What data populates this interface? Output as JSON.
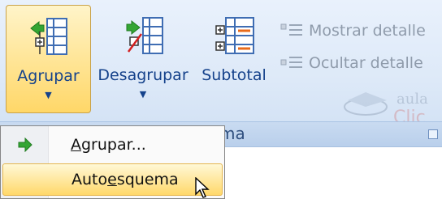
{
  "ribbon": {
    "group_label": "ma",
    "buttons": {
      "agrupar": "Agrupar",
      "desagrupar": "Desagrupar",
      "subtotal": "Subtotal",
      "mostrar_detalle": "Mostrar detalle",
      "ocultar_detalle": "Ocultar detalle"
    },
    "watermark": "aula Clic"
  },
  "menu": {
    "items": [
      {
        "label_pre": "",
        "label_key": "A",
        "label_post": "grupar..."
      },
      {
        "label_pre": "Auto",
        "label_key": "e",
        "label_post": "squema"
      }
    ]
  },
  "colors": {
    "ribbon_bg": "#dde9f8",
    "label_text": "#15428b",
    "hover_accent": "#ffd768",
    "green_arrow": "#2ea52e"
  },
  "icons": [
    "group-icon",
    "ungroup-icon",
    "subtotal-icon",
    "show-detail-icon",
    "hide-detail-icon",
    "green-arrow-icon",
    "mouse-cursor-icon"
  ]
}
